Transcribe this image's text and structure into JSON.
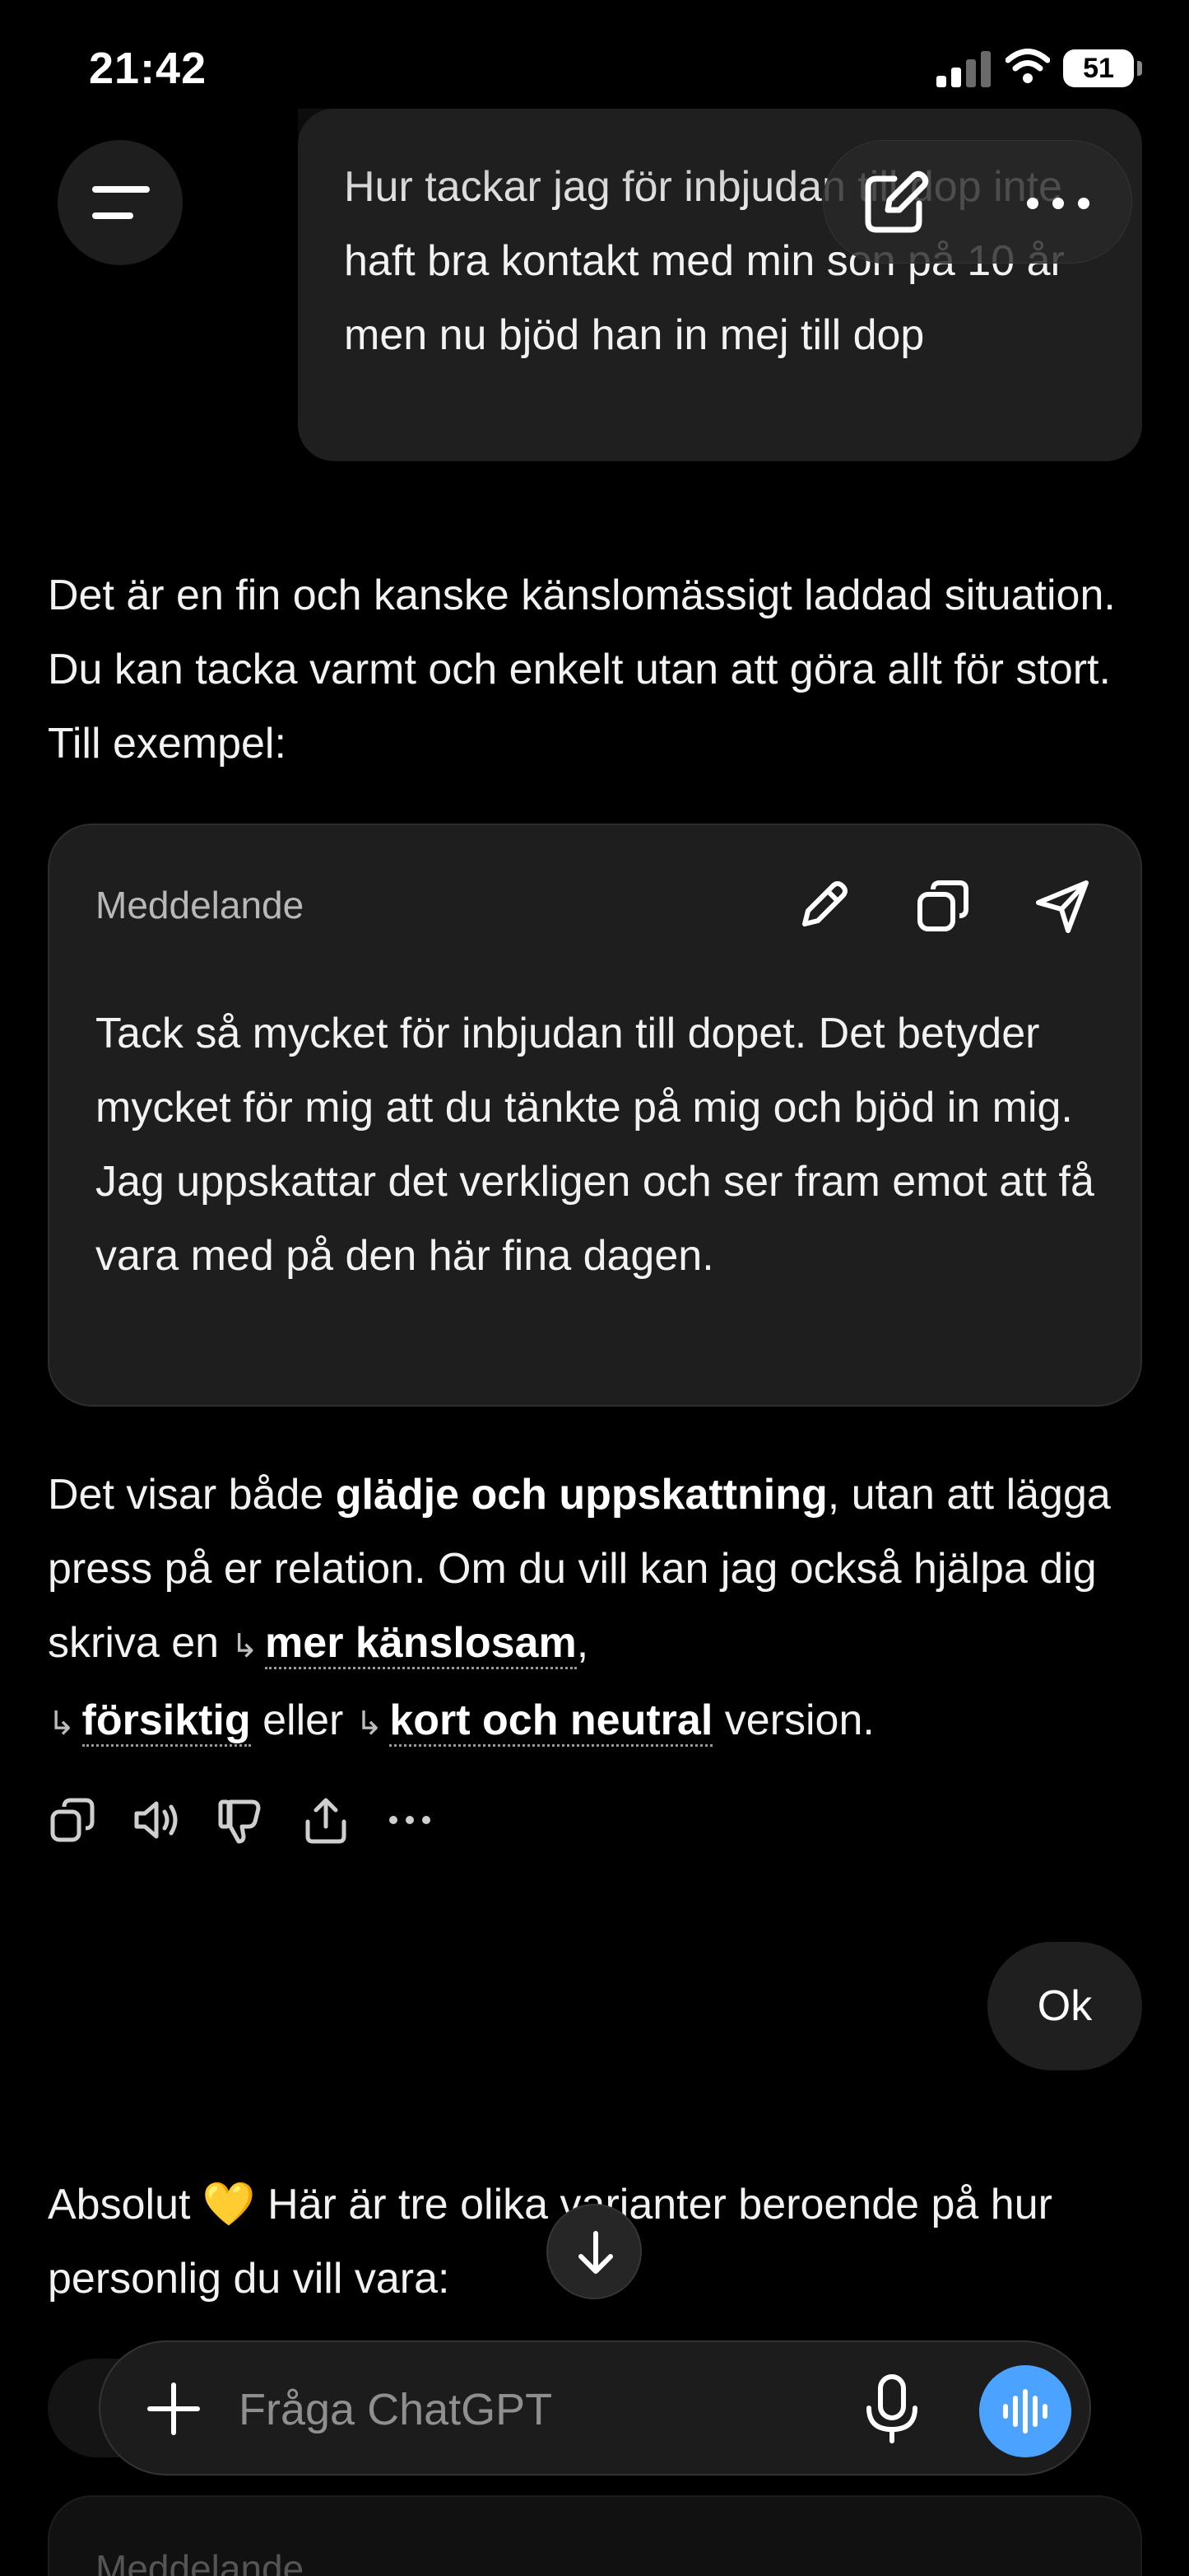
{
  "status_bar": {
    "time": "21:42",
    "battery": "51"
  },
  "conversation": {
    "user_message_1": "Hur tackar jag för inbjudan till dop inte haft bra kontakt med min son på 10 år men nu bjöd han in mej till dop",
    "assistant_intro": "Det är en fin och kanske känslomässigt laddad situation. Du kan tacka varmt och enkelt utan att göra allt för stort. Till exempel:",
    "card": {
      "title": "Meddelande",
      "body": "Tack så mycket för inbjudan till dopet. Det betyder mycket för mig att du tänkte på mig och bjöd in mig. Jag uppskattar det verkligen och ser fram emot att få vara med på den här fina dagen."
    },
    "followup": {
      "part1": "Det visar både ",
      "bold": "glädje och uppskattning",
      "part2": ", utan att lägga press på er relation. Om du vill kan jag också hjälpa dig skriva en ",
      "link1": "mer känslosam",
      "comma": ",",
      "link2": "försiktig",
      "part3": " eller ",
      "link3": "kort och neutral",
      "part4": " version."
    },
    "user_message_2": "Ok",
    "assistant_second": "Absolut 💛 Här är tre olika varianter beroende på hur personlig du vill vara:",
    "ghost_card_title": "Meddelande"
  },
  "input": {
    "placeholder": "Fråga ChatGPT"
  },
  "icons": {
    "menu": "menu-icon",
    "new_chat": "edit-icon",
    "more": "more-icon",
    "pencil": "pencil-icon",
    "copy": "copy-icon",
    "send": "send-icon",
    "speaker": "speaker-icon",
    "thumbs_down": "thumbs-down-icon",
    "share": "share-icon",
    "scroll_down": "arrow-down-icon",
    "plus": "plus-icon",
    "mic": "mic-icon",
    "voice": "voice-icon"
  },
  "colors": {
    "background": "#000000",
    "bubble": "#1f1f1f",
    "voice_button": "#4ba3ff"
  }
}
